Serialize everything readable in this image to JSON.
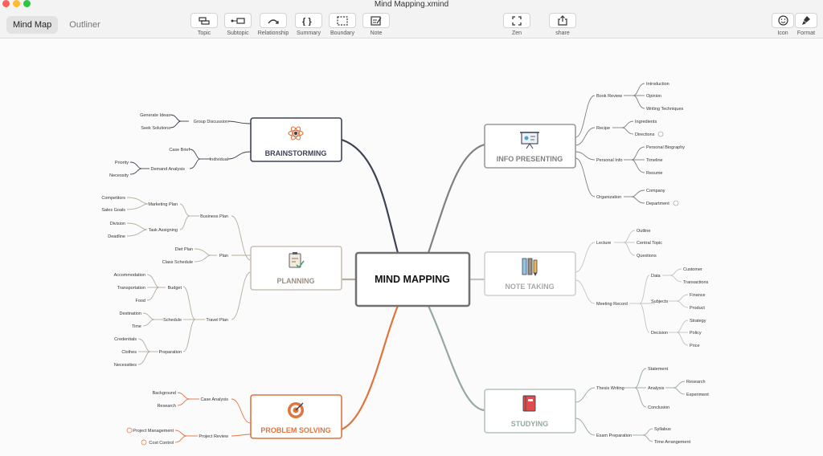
{
  "window": {
    "title": "Mind Mapping.xmind"
  },
  "view_toggle": {
    "mind_map": "Mind Map",
    "outliner": "Outliner"
  },
  "toolbar": {
    "topic": "Topic",
    "subtopic": "Subtopic",
    "relationship": "Relationship",
    "summary": "Summary",
    "boundary": "Boundary",
    "note": "Note",
    "zen": "Zen",
    "share": "share",
    "icon": "Icon",
    "format": "Format"
  },
  "colors": {
    "brainstorming": "#3d4355",
    "planning": "#9a8f7d",
    "problem": "#e0743d",
    "info": "#808080",
    "note": "#a9a9a9",
    "studying": "#96a8a2"
  },
  "map": {
    "central": "MIND MAPPING",
    "brainstorming": {
      "title": "BRAINSTORMING",
      "group_discussion": "Group Discussion",
      "generate_ideas": "Generate Ideas",
      "seek_solutions": "Seek Solutions",
      "individual": "Individual",
      "case_brief": "Case Brief",
      "demand_analysis": "Demand Analysis",
      "priority": "Priority",
      "necessity": "Necessity"
    },
    "planning": {
      "title": "PLANNING",
      "business_plan": "Business Plan",
      "marketing_plan": "Marketing Plan",
      "competitors": "Competitors",
      "sales_goals": "Sales Goals",
      "task_assigning": "Task Assigning",
      "division": "Division",
      "deadline": "Deadline",
      "plan": "Plan",
      "diet_plan": "Diet Plan",
      "class_schedule": "Class Schedule",
      "travel_plan": "Travel Plan",
      "budget": "Budget",
      "accommodation": "Accommodation",
      "transportation": "Transportation",
      "food": "Food",
      "schedule": "Schedule",
      "destination": "Destination",
      "time": "Time",
      "preparation": "Preparation",
      "credentials": "Credentials",
      "clothes": "Clothes",
      "necessities": "Necessities"
    },
    "problem": {
      "title": "PROBLEM SOLVING",
      "case_analysis": "Case Analysis",
      "background": "Background",
      "research": "Research",
      "project_review": "Project Review",
      "project_management": "Project Management",
      "cost_control": "Cost Control"
    },
    "info": {
      "title": "INFO PRESENTING",
      "book_review": "Book Review",
      "introduction": "Introduction",
      "opinion": "Opinion",
      "writing_techniques": "Writing Techniques",
      "recipe": "Recipe",
      "ingredients": "Ingredients",
      "directions": "Directions",
      "personal_info": "Personal Info",
      "personal_biography": "Personal Biography",
      "timeline": "Timeline",
      "resume": "Resume",
      "organization": "Organization",
      "company": "Company",
      "department": "Department"
    },
    "note": {
      "title": "NOTE TAKING",
      "lecture": "Lecture",
      "outline": "Outline",
      "central_topic": "Central Topic",
      "questions": "Questions",
      "meeting_record": "Meeting Record",
      "data": "Data",
      "customer": "Customer",
      "transactions": "Transactions",
      "subjects": "Subjects",
      "finance": "Finance",
      "product": "Product",
      "decision": "Decision",
      "strategy": "Strategy",
      "policy": "Policy",
      "price": "Price"
    },
    "studying": {
      "title": "STUDYING",
      "thesis_writing": "Thesis Writing",
      "statement": "Statement",
      "analysis": "Analysis",
      "research": "Research",
      "experiment": "Experiment",
      "conclusion": "Conclusion",
      "exam_preparation": "Exam Preparation",
      "syllabus": "Syllabus",
      "time_arrangement": "Time Arrangement"
    }
  }
}
